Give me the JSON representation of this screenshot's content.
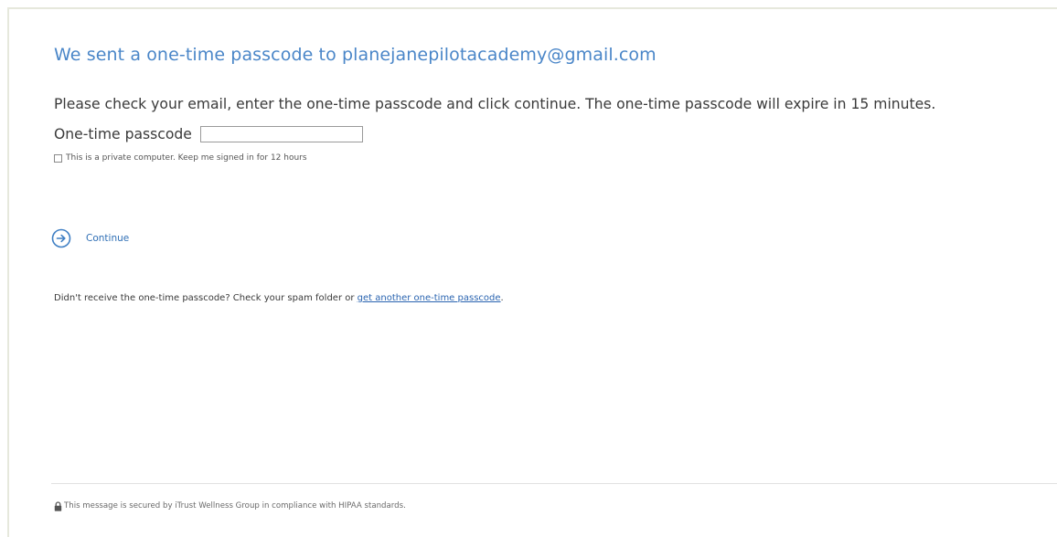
{
  "header": {
    "title": "We sent a one-time passcode to planejanepilotacademy@gmail.com"
  },
  "form": {
    "instructions": "Please check your email, enter the one-time passcode and click continue. The one-time passcode will expire in 15 minutes.",
    "passcode_label": "One-time passcode",
    "passcode_value": "",
    "keep_signed_in_label": "This is a private computer. Keep me signed in for 12 hours",
    "keep_signed_in_checked": false,
    "continue_label": "Continue",
    "continue_icon": "arrow-right-circle-icon"
  },
  "resend": {
    "prefix": "Didn't receive the one-time passcode? Check your spam folder or ",
    "link_text": "get another one-time passcode",
    "suffix": "."
  },
  "footer": {
    "icon": "lock-icon",
    "text": "This message is secured by iTrust Wellness Group in compliance with HIPAA standards."
  },
  "colors": {
    "heading": "#4a86c8",
    "link": "#2a64b0",
    "continue_icon": "#3f7fc4"
  }
}
